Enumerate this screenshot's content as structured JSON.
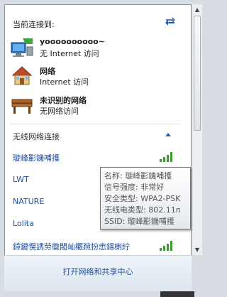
{
  "header": {
    "title": "当前连接到:"
  },
  "connections": [
    {
      "name": "yoooooooooo~",
      "status": "无 Internet 访问",
      "icon": "computer-network-icon"
    },
    {
      "name": "网络",
      "status": "Internet 访问",
      "icon": "home-network-icon"
    },
    {
      "name": "未识别的网络",
      "status": "无网络访问",
      "icon": "bench-network-icon"
    }
  ],
  "wireless": {
    "section_label": "无线网络连接",
    "networks": [
      {
        "label": "璇峰彲鐖哺擭"
      },
      {
        "label": "LWT"
      },
      {
        "label": "NATURE"
      },
      {
        "label": "Lolita"
      },
      {
        "label": "鏱鍵愰誘劳徽閥屾欟踠扮悆鍚楋紵"
      }
    ]
  },
  "tooltip": {
    "rows": [
      "名称: 璇峰彲鐖哺擭",
      "信号强度: 非常好",
      "安全类型: WPA2-PSK",
      "无线电类型: 802.11n",
      "SSID: 璇峰彲鐖哺擭"
    ]
  },
  "footer": {
    "link": "打开网络和共享中心"
  },
  "colors": {
    "link": "#1e4f9c",
    "signal": "#3c9a2e",
    "panel": "#ffffff"
  }
}
